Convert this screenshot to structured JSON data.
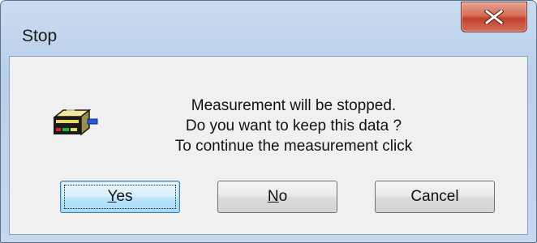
{
  "window": {
    "title": "Stop"
  },
  "message": {
    "lines": [
      "Measurement will be stopped.",
      "Do you want to keep this data ?",
      "To continue the measurement click"
    ]
  },
  "buttons": {
    "yes": {
      "mnemonic": "Y",
      "rest": "es"
    },
    "no": {
      "mnemonic": "N",
      "rest": "o"
    },
    "cancel": {
      "label": "Cancel"
    }
  },
  "icons": {
    "close": "close-icon",
    "app": "measurement-device-icon"
  },
  "colors": {
    "close_button": "#c8452f",
    "default_button_border": "#3c7fb1",
    "client_background": "#f0f0f0"
  }
}
